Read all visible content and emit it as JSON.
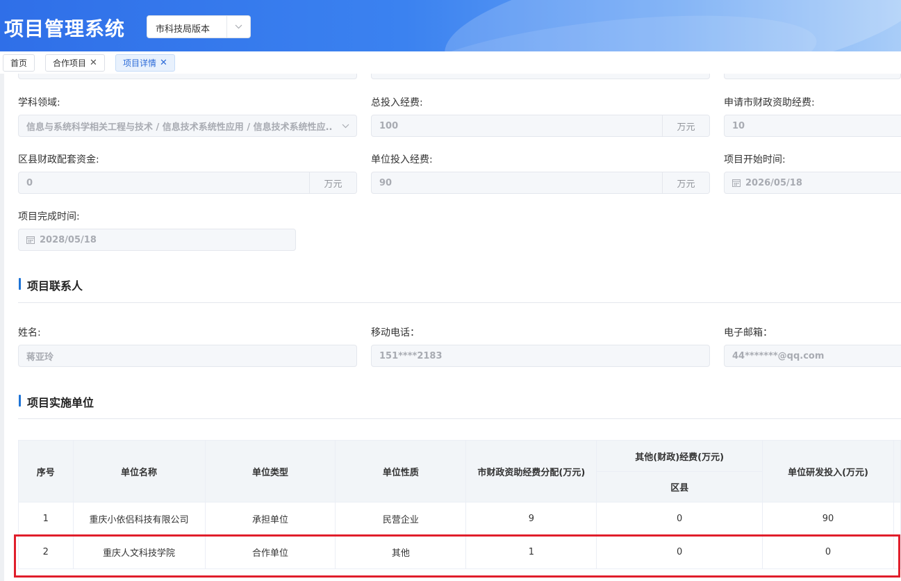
{
  "header": {
    "app_title": "项目管理系统",
    "version_select": "市科技局版本"
  },
  "tabs": [
    {
      "label": "首页"
    },
    {
      "label": "合作项目"
    },
    {
      "label": "项目详情"
    }
  ],
  "form": {
    "discipline": {
      "label": "学科领域:",
      "value": "信息与系统科学相关工程与技术 / 信息技术系统性应用 / 信息技术系统性应..."
    },
    "total_investment": {
      "label": "总投入经费:",
      "value": "100",
      "unit": "万元"
    },
    "city_funding": {
      "label": "申请市财政资助经费:",
      "value": "10"
    },
    "county_matching": {
      "label": "区县财政配套资金:",
      "value": "0",
      "unit": "万元"
    },
    "unit_investment": {
      "label": "单位投入经费:",
      "value": "90",
      "unit": "万元"
    },
    "start_date": {
      "label": "项目开始时间:",
      "value": "2026/05/18"
    },
    "end_date": {
      "label": "项目完成时间:",
      "value": "2028/05/18"
    }
  },
  "contact_section": {
    "title": "项目联系人",
    "name": {
      "label": "姓名:",
      "value": "蒋亚玲"
    },
    "mobile": {
      "label": "移动电话：",
      "value": "151****2183"
    },
    "email": {
      "label": "电子邮箱：",
      "value": "44*******@qq.com"
    }
  },
  "units_section": {
    "title": "项目实施单位",
    "headers": {
      "seq": "序号",
      "name": "单位名称",
      "type": "单位类型",
      "nature": "单位性质",
      "city_alloc": "市财政资助经费分配(万元)",
      "other_group": "其他(财政)经费(万元)",
      "county": "区县",
      "rd_invest": "单位研发投入(万元)"
    },
    "rows": [
      {
        "seq": "1",
        "name": "重庆小依侣科技有限公司",
        "type": "承担单位",
        "nature": "民营企业",
        "city_alloc": "9",
        "county": "0",
        "rd_invest": "90"
      },
      {
        "seq": "2",
        "name": "重庆人文科技学院",
        "type": "合作单位",
        "nature": "其他",
        "city_alloc": "1",
        "county": "0",
        "rd_invest": "0"
      }
    ]
  },
  "colors": {
    "accent": "#1f74d6",
    "highlight_border": "#e01e2b"
  },
  "icons": {
    "calendar": "calendar-icon",
    "chevron": "chevron-down-icon",
    "close": "close-icon"
  }
}
